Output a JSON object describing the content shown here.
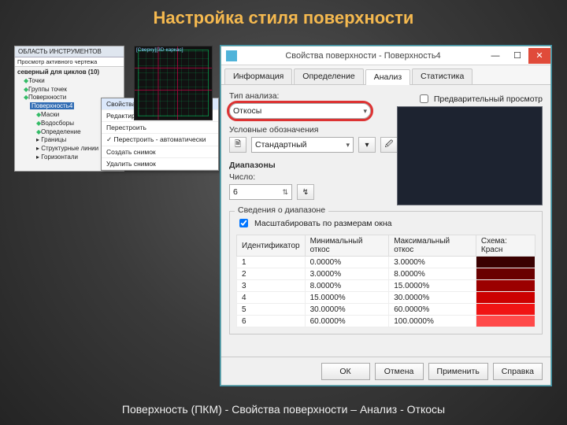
{
  "slide": {
    "title": "Настройка стиля поверхности",
    "caption": "Поверхность (ПКМ) - Свойства поверхности – Анализ - Откосы"
  },
  "toolspace": {
    "title": "ОБЛАСТЬ ИНСТРУМЕНТОВ",
    "subtitle": "Просмотр активного чертежа",
    "root": "северный для циклов (10)",
    "items": [
      "Точки",
      "Группы точек",
      "Поверхности",
      "Поверхность4",
      "Маски",
      "Водосборы",
      "Определение",
      "Границы",
      "Структурные линии",
      "Горизонтали"
    ],
    "selected_index": 3
  },
  "context_menu": {
    "items": [
      "Свойства поверхности...",
      "Редактировать стиль поверхности...",
      "Перестроить",
      "Перестроить - автоматически",
      "Создать снимок",
      "Удалить снимок"
    ],
    "selected_index": 0
  },
  "viewport_label": "[Сверху][3D-каркас]",
  "dialog": {
    "title": "Свойства поверхности - Поверхность4",
    "tabs": [
      "Информация",
      "Определение",
      "Анализ",
      "Статистика"
    ],
    "active_tab_index": 2,
    "labels": {
      "analysis_type": "Тип анализа:",
      "legend": "Условные обозначения",
      "ranges": "Диапазоны",
      "number": "Число:",
      "range_info": "Сведения о диапазоне",
      "scale_to_fit": "Масштабировать по размерам окна",
      "preview": "Предварительный просмотр"
    },
    "analysis_type_value": "Откосы",
    "legend_value": "Стандартный",
    "range_count": "6",
    "scale_to_fit_checked": true,
    "preview_checked": false,
    "columns": [
      "Идентификатор",
      "Минимальный откос",
      "Максимальный откос",
      "Схема: Красн"
    ],
    "rows": [
      {
        "id": "1",
        "min": "0.0000%",
        "max": "3.0000%",
        "color": "#3a0000"
      },
      {
        "id": "2",
        "min": "3.0000%",
        "max": "8.0000%",
        "color": "#6a0000"
      },
      {
        "id": "3",
        "min": "8.0000%",
        "max": "15.0000%",
        "color": "#9b0000"
      },
      {
        "id": "4",
        "min": "15.0000%",
        "max": "30.0000%",
        "color": "#cc0000"
      },
      {
        "id": "5",
        "min": "30.0000%",
        "max": "60.0000%",
        "color": "#f01414"
      },
      {
        "id": "6",
        "min": "60.0000%",
        "max": "100.0000%",
        "color": "#ff4a4a"
      }
    ],
    "buttons": {
      "ok": "ОК",
      "cancel": "Отмена",
      "apply": "Применить",
      "help": "Справка"
    }
  }
}
